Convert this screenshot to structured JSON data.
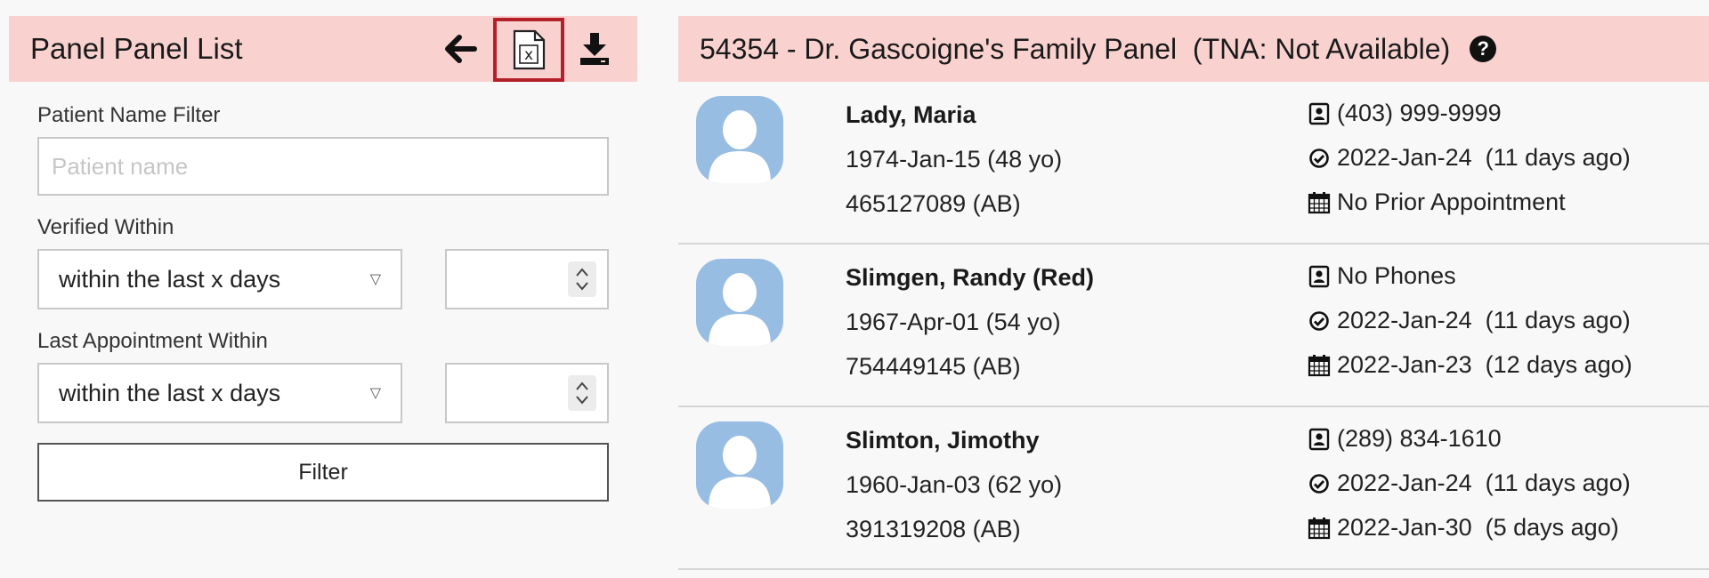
{
  "left_panel": {
    "title": "Panel Panel List",
    "filters": {
      "patient_name_label": "Patient Name Filter",
      "patient_name_placeholder": "Patient name",
      "patient_name_value": "",
      "verified_label": "Verified Within",
      "verified_select": "within the last x days",
      "last_appt_label": "Last Appointment Within",
      "last_appt_select": "within the last x days",
      "filter_button": "Filter"
    }
  },
  "right_panel": {
    "title": "54354 - Dr. Gascoigne's Family Panel  (TNA: Not Available)",
    "patients": [
      {
        "name": "Lady, Maria",
        "dob": "1974-Jan-15 (48 yo)",
        "health_card": "465127089 (AB)",
        "phone": "(403) 999-9999",
        "verified": "2022-Jan-24  (11 days ago)",
        "last_appointment": "No Prior Appointment"
      },
      {
        "name": "Slimgen, Randy (Red)",
        "dob": "1967-Apr-01 (54 yo)",
        "health_card": "754449145 (AB)",
        "phone": "No Phones",
        "verified": "2022-Jan-24  (11 days ago)",
        "last_appointment": "2022-Jan-23  (12 days ago)"
      },
      {
        "name": "Slimton, Jimothy",
        "dob": "1960-Jan-03 (62 yo)",
        "health_card": "391319208 (AB)",
        "phone": "(289) 834-1610",
        "verified": "2022-Jan-24  (11 days ago)",
        "last_appointment": "2022-Jan-30  (5 days ago)"
      }
    ]
  },
  "colors": {
    "header_bg": "#f9d2d0",
    "avatar_bg": "#98bde3",
    "excel_highlight": "#b3202a"
  },
  "icons": {
    "back": "arrow-left-icon",
    "export_excel": "excel-file-icon",
    "download": "download-icon",
    "help": "question-circle-icon",
    "phone": "contact-card-icon",
    "verified": "check-circle-icon",
    "appointment": "calendar-icon"
  }
}
